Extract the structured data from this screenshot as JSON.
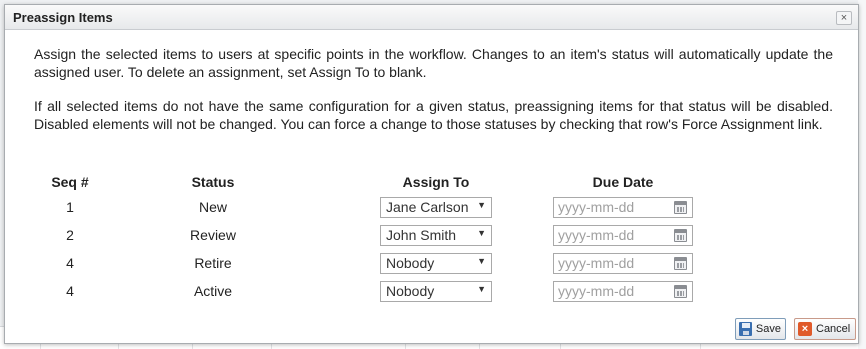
{
  "dialog": {
    "title": "Preassign Items",
    "close_label": "×",
    "description_1": "Assign the selected items to users at specific points in the workflow. Changes to an item's status will automatically update the assigned user. To delete an assignment, set Assign To to blank.",
    "description_2": "If all selected items do not have the same configuration for a given status, preassigning items for that status will be disabled. Disabled elements will not be changed. You can force a change to those statuses by checking that row's Force Assignment link."
  },
  "table": {
    "headers": [
      "Seq #",
      "Status",
      "Assign To",
      "Due Date"
    ],
    "rows": [
      {
        "seq": "1",
        "status": "New",
        "assign_to": "Jane Carlson",
        "due_placeholder": "yyyy-mm-dd"
      },
      {
        "seq": "2",
        "status": "Review",
        "assign_to": "John Smith",
        "due_placeholder": "yyyy-mm-dd"
      },
      {
        "seq": "4",
        "status": "Retire",
        "assign_to": "Nobody",
        "due_placeholder": "yyyy-mm-dd"
      },
      {
        "seq": "4",
        "status": "Active",
        "assign_to": "Nobody",
        "due_placeholder": "yyyy-mm-dd"
      }
    ]
  },
  "buttons": {
    "save_label": "Save",
    "cancel_label": "Cancel"
  },
  "icons": {
    "dropdown": "chevron-down-icon",
    "calendar": "calendar-icon",
    "save": "save-icon",
    "cancel": "cancel-icon",
    "close": "close-icon"
  }
}
